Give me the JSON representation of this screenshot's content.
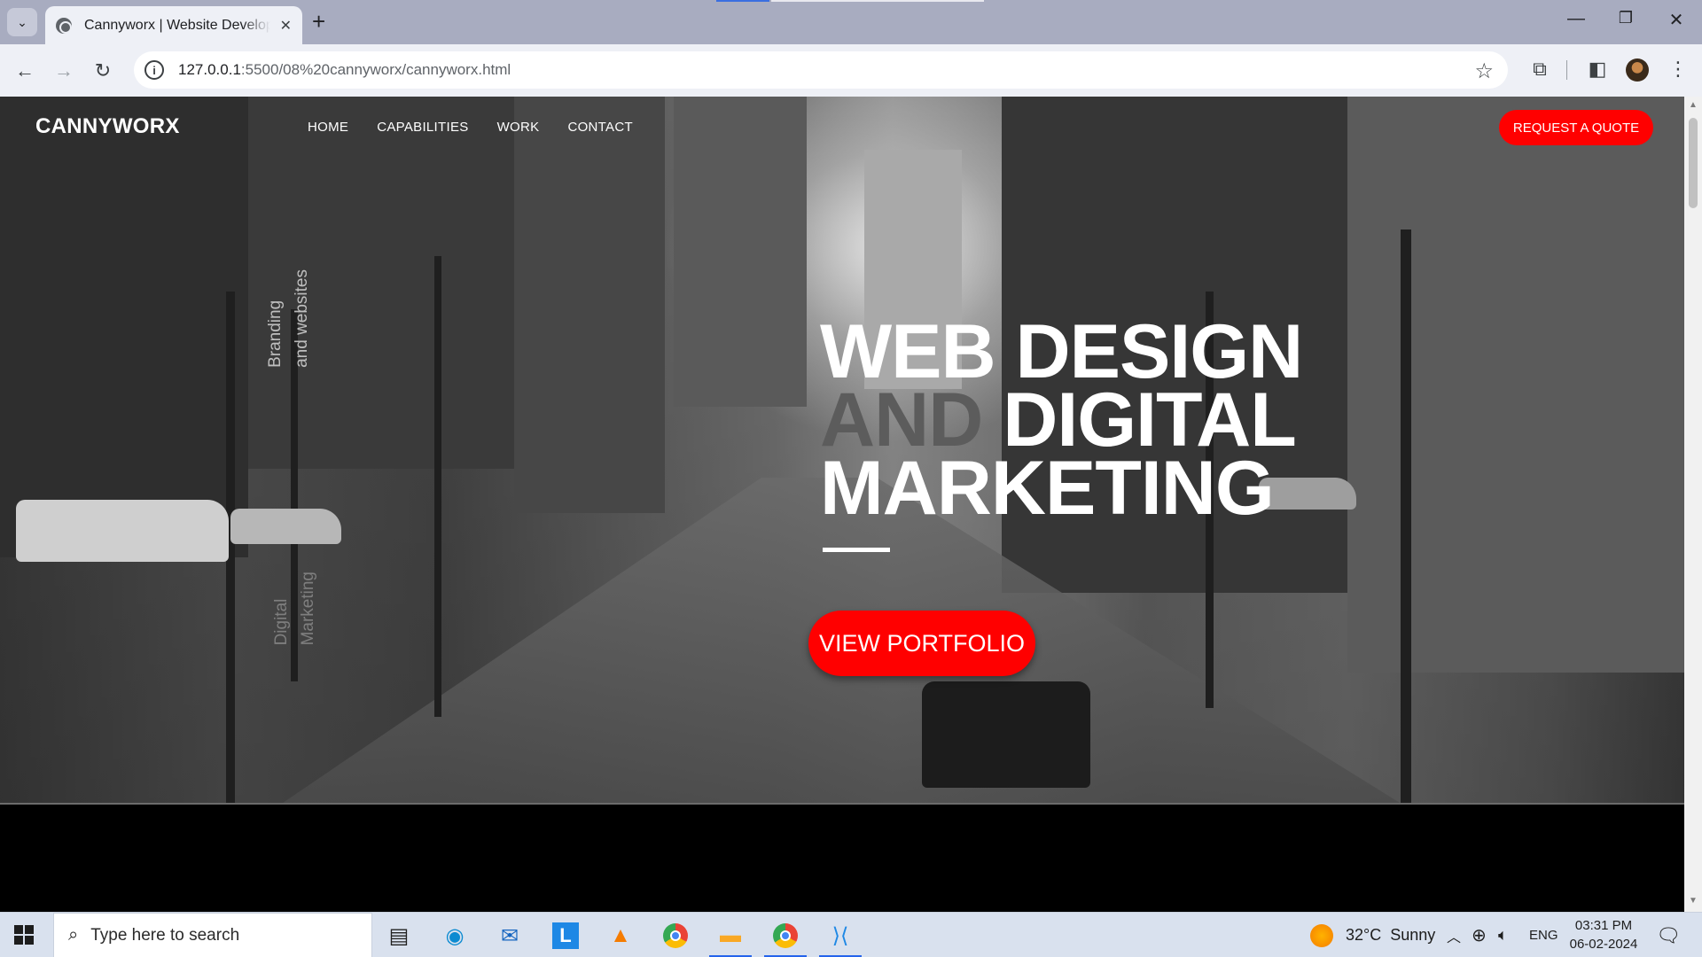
{
  "browser": {
    "tab_title": "Cannyworx | Website Development",
    "tab_close": "✕",
    "new_tab": "+",
    "url_host": "127.0.0.1",
    "url_path": ":5500/08%20cannyworx/cannyworx.html",
    "window_controls": {
      "minimize": "—",
      "restore": "❐",
      "close": "✕"
    }
  },
  "site": {
    "logo": "CANNYWORX",
    "nav": [
      "HOME",
      "CAPABILITIES",
      "WORK",
      "CONTACT"
    ],
    "quote_button": "REQUEST A QUOTE",
    "side_text_1_line1": "Branding",
    "side_text_1_line2": "and websites",
    "side_text_2_line1": "Digital",
    "side_text_2_line2": "Marketing",
    "headline_line1": "WEB DESIGN",
    "headline_line2_dim": "AND",
    "headline_line2_rest": " DIGITAL",
    "headline_line3": "MARKETING",
    "portfolio_button": "VIEW PORTFOLIO",
    "accent_color": "#ff0000"
  },
  "taskbar": {
    "search_placeholder": "Type here to search",
    "weather_temp": "32°C",
    "weather_desc": "Sunny",
    "language": "ENG",
    "time": "03:31 PM",
    "date": "06-02-2024",
    "apps": [
      "task-view-icon",
      "edge-icon",
      "mail-icon",
      "l-app-icon",
      "vlc-icon",
      "chrome-icon",
      "file-explorer-icon",
      "chrome-profile-icon",
      "vscode-icon"
    ]
  }
}
